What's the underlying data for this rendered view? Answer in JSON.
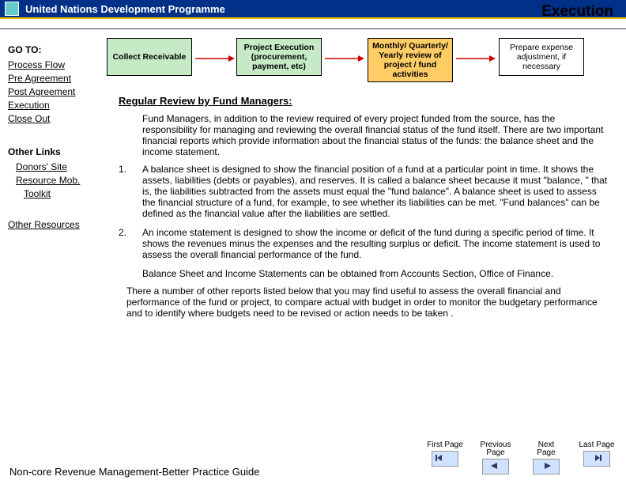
{
  "header": {
    "title": "United Nations Development Programme"
  },
  "page_title": "Execution",
  "sidebar": {
    "goto_heading": "GO TO:",
    "nav_links": {
      "process_flow": "Process Flow",
      "pre_agreement": "Pre Agreement",
      "post_agreement": "Post Agreement",
      "execution": "Execution",
      "close_out": "Close Out"
    },
    "other_links_heading": "Other Links",
    "other_links": {
      "donors_site": "Donors' Site",
      "resource_mob": "Resource Mob.",
      "toolkit": "Toolkit"
    },
    "other_resources": "Other Resources"
  },
  "flow": {
    "box1": "Collect Receivable",
    "box2": "Project Execution (procurement, payment, etc)",
    "box3": "Monthly/ Quarterly/ Yearly review of project / fund activities",
    "box4": "Prepare expense adjustment, if necessary"
  },
  "main": {
    "subhead": "Regular Review by Fund Managers:",
    "intro": "Fund Managers, in addition to the review required of every project funded from the source, has the responsibility for managing and reviewing the overall financial status of the fund itself.  There are two important financial reports which provide information about the  financial status of the funds: the balance sheet and  the income statement.",
    "li1_n": "1.",
    "li1_t": "A balance sheet is designed to show the financial position of a fund at a particular point in time. It shows the assets, liabilities (debts or payables), and reserves.  It is called a balance sheet because it must \"balance, \" that is, the liabilities subtracted from the assets must equal the \"fund balance\". A balance sheet is used to assess the financial structure of a fund, for example, to see whether its liabilities can be met. \"Fund balances\" can be defined as the financial value after the liabilities are settled.",
    "li2_n": "2.",
    "li2_t": "An income statement is designed to show the income or deficit of the fund during a specific period of time. It shows the revenues minus the expenses and the resulting surplus or deficit. The income statement is used to assess the overall financial performance of the fund.",
    "para3": "Balance Sheet and Income Statements can be obtained from Accounts Section, Office of Finance.",
    "para4": "There a number of other reports listed below that you may find useful to assess the overall financial and performance of the fund or project, to compare actual with budget in order to monitor the budgetary performance and to identify where budgets need to be revised or action needs to be taken ."
  },
  "footer": {
    "left": "Non-core Revenue Management-Better Practice Guide",
    "nav": {
      "first": "First Page",
      "prev": "Previous Page",
      "next": "Next Page",
      "last": "Last Page"
    }
  }
}
